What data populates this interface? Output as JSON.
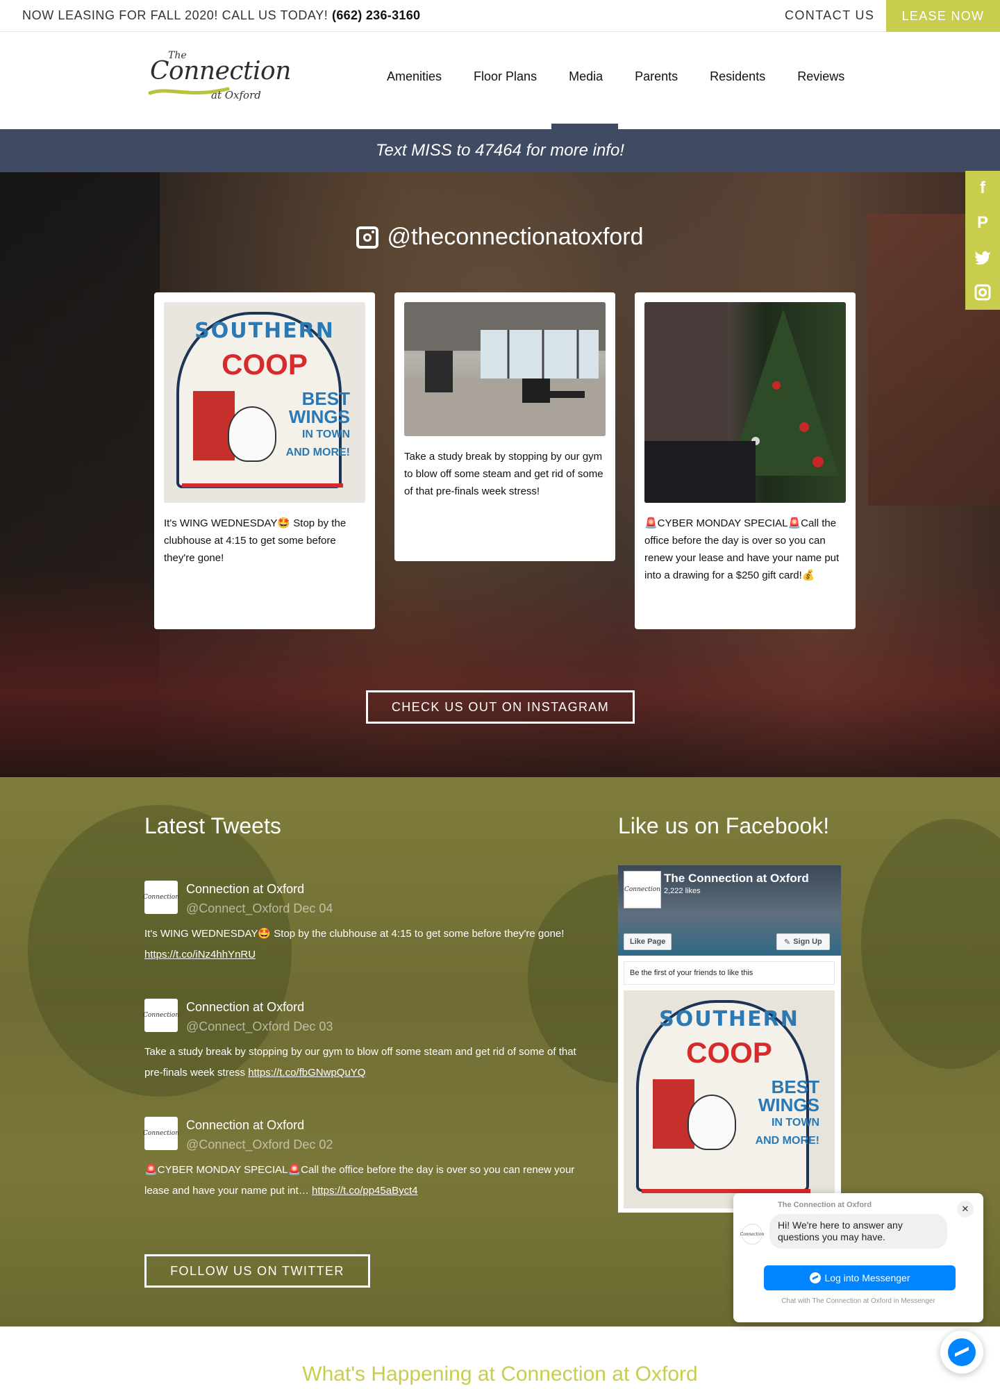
{
  "topbar": {
    "promo_text": "NOW LEASING FOR FALL 2020! CALL US TODAY!",
    "phone": "(662) 236-3160",
    "contact_label": "CONTACT US",
    "lease_label": "LEASE NOW"
  },
  "logo": {
    "the": "The",
    "name": "Connection",
    "at": "at Oxford"
  },
  "nav": {
    "items": [
      "Amenities",
      "Floor Plans",
      "Media",
      "Parents",
      "Residents",
      "Reviews"
    ],
    "active": "Media"
  },
  "text_band": "Text MISS to 47464 for more info!",
  "instagram": {
    "handle": "@theconnectionatoxford",
    "posts": [
      {
        "caption": "It's WING WEDNESDAY🤩 Stop by the clubhouse at 4:15 to get some before they're gone!"
      },
      {
        "caption": "Take a study break by stopping by our gym to blow off some steam and get rid of some of that pre-finals week stress!"
      },
      {
        "caption": "🚨CYBER MONDAY SPECIAL🚨Call the office before the day is over so you can renew your lease and have your name put into a drawing for a $250 gift card!💰"
      }
    ],
    "button_label": "CHECK US OUT ON INSTAGRAM"
  },
  "sign": {
    "top": "SOUTHERN",
    "middle": "COOP",
    "side_1": "BEST",
    "side_2": "WINGS",
    "side_3": "IN TOWN",
    "side_4": "AND MORE!"
  },
  "social_rail": [
    "facebook-icon",
    "pinterest-icon",
    "twitter-icon",
    "instagram-icon"
  ],
  "tweets": {
    "heading": "Latest Tweets",
    "items": [
      {
        "name": "Connection at Oxford",
        "meta": "@Connect_Oxford Dec 04",
        "text": "It's WING WEDNESDAY🤩 Stop by the clubhouse at 4:15 to get some before they're gone!",
        "link": "https://t.co/iNz4hhYnRU"
      },
      {
        "name": "Connection at Oxford",
        "meta": "@Connect_Oxford Dec 03",
        "text": "Take a study break by stopping by our gym to blow off some steam and get rid of some of that pre-finals week stress",
        "link": "https://t.co/fbGNwpQuYQ"
      },
      {
        "name": "Connection at Oxford",
        "meta": "@Connect_Oxford Dec 02",
        "text": "🚨CYBER MONDAY SPECIAL🚨Call the office before the day is over so you can renew your lease and have your name put int…",
        "link": "https://t.co/pp45aByct4"
      }
    ],
    "button_label": "FOLLOW US ON TWITTER"
  },
  "facebook": {
    "heading": "Like us on Facebook!",
    "page_name": "The Connection at Oxford",
    "likes": "2,222 likes",
    "like_label": "Like Page",
    "signup_label": "Sign Up",
    "friends_text": "Be the first of your friends to like this"
  },
  "chat": {
    "page_name": "The Connection at Oxford",
    "message": "Hi! We're here to answer any questions you may have.",
    "login_label": "Log into Messenger",
    "hint": "Chat with The Connection at Oxford in Messenger"
  },
  "bottom_heading": "What's Happening at Connection at Oxford",
  "colors": {
    "accent": "#c9cd4d",
    "navy": "#3f4a63",
    "messenger": "#0084ff"
  }
}
